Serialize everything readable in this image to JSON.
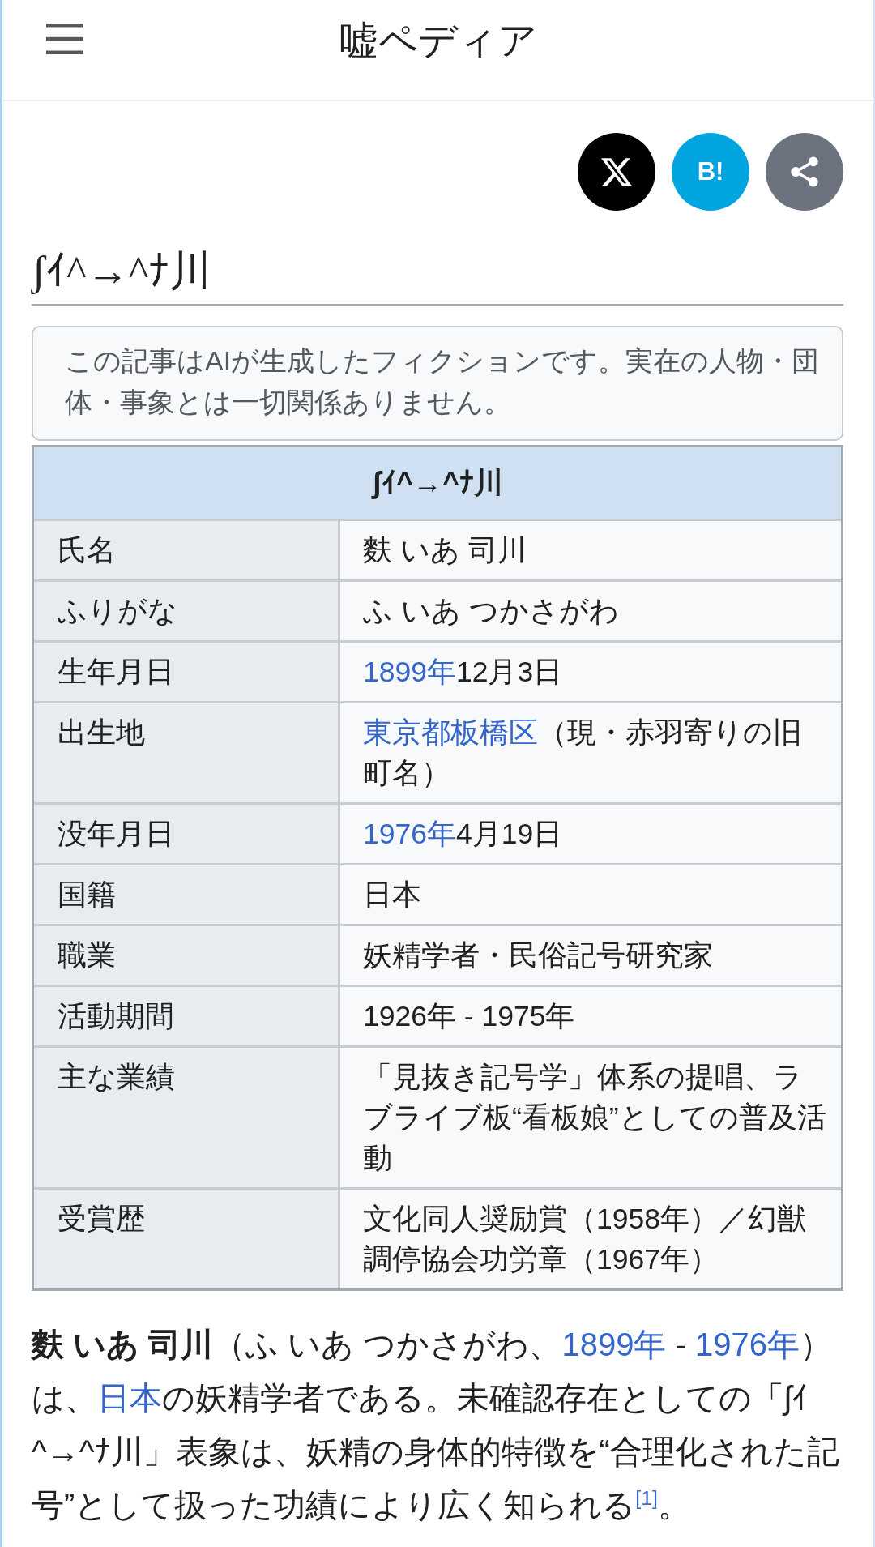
{
  "header": {
    "title": "嘘ペディア"
  },
  "share_buttons": [
    {
      "kind": "x"
    },
    {
      "kind": "bookmark",
      "label": "B!"
    },
    {
      "kind": "share"
    }
  ],
  "article": {
    "title": "ʃｲ^→^ﾅ川"
  },
  "notice": {
    "text": "この記事はAIが生成したフィクションです。実在の人物・団体・事象とは一切関係ありません。"
  },
  "infobox": {
    "title": "ʃｲ^→^ﾅ川",
    "rows": [
      {
        "label": "氏名",
        "value": [
          {
            "kind": "text",
            "text": "麩 いあ 司川"
          }
        ]
      },
      {
        "label": "ふりがな",
        "value": [
          {
            "kind": "text",
            "text": "ふ いあ つかさがわ"
          }
        ]
      },
      {
        "label": "生年月日",
        "value": [
          {
            "kind": "link",
            "text": "1899年"
          },
          {
            "kind": "text",
            "text": "12月3日"
          }
        ]
      },
      {
        "label": "出生地",
        "value": [
          {
            "kind": "link",
            "text": "東京都板橋区"
          },
          {
            "kind": "text",
            "text": "（現・赤羽寄りの旧町名）"
          }
        ]
      },
      {
        "label": "没年月日",
        "value": [
          {
            "kind": "link",
            "text": "1976年"
          },
          {
            "kind": "text",
            "text": "4月19日"
          }
        ]
      },
      {
        "label": "国籍",
        "value": [
          {
            "kind": "text",
            "text": "日本"
          }
        ]
      },
      {
        "label": "職業",
        "value": [
          {
            "kind": "text",
            "text": "妖精学者・民俗記号研究家"
          }
        ]
      },
      {
        "label": "活動期間",
        "value": [
          {
            "kind": "text",
            "text": "1926年 - 1975年"
          }
        ]
      },
      {
        "label": "主な業績",
        "value": [
          {
            "kind": "text",
            "text": "「見抜き記号学」体系の提唱、ラブライブ板“看板娘”としての普及活動"
          }
        ]
      },
      {
        "label": "受賞歴",
        "value": [
          {
            "kind": "text",
            "text": "文化同人奨励賞（1958年）／幻獣調停協会功労章（1967年）"
          }
        ]
      }
    ]
  },
  "lead": {
    "segments": [
      {
        "kind": "bold",
        "text": "麩 いあ 司川"
      },
      {
        "kind": "text",
        "text": "（ふ いあ つかさがわ、"
      },
      {
        "kind": "link",
        "text": "1899年"
      },
      {
        "kind": "text",
        "text": " - "
      },
      {
        "kind": "link",
        "text": "1976年"
      },
      {
        "kind": "text",
        "text": "）は、"
      },
      {
        "kind": "link",
        "text": "日本"
      },
      {
        "kind": "text",
        "text": "の妖精学者である。未確認存在としての「ʃｲ^→^ﾅ川」表象は、妖精の身体的特徴を“合理化された記号”として扱った功績により広く知られる"
      },
      {
        "kind": "ref",
        "text": "[1]"
      },
      {
        "kind": "text",
        "text": "。"
      }
    ]
  }
}
